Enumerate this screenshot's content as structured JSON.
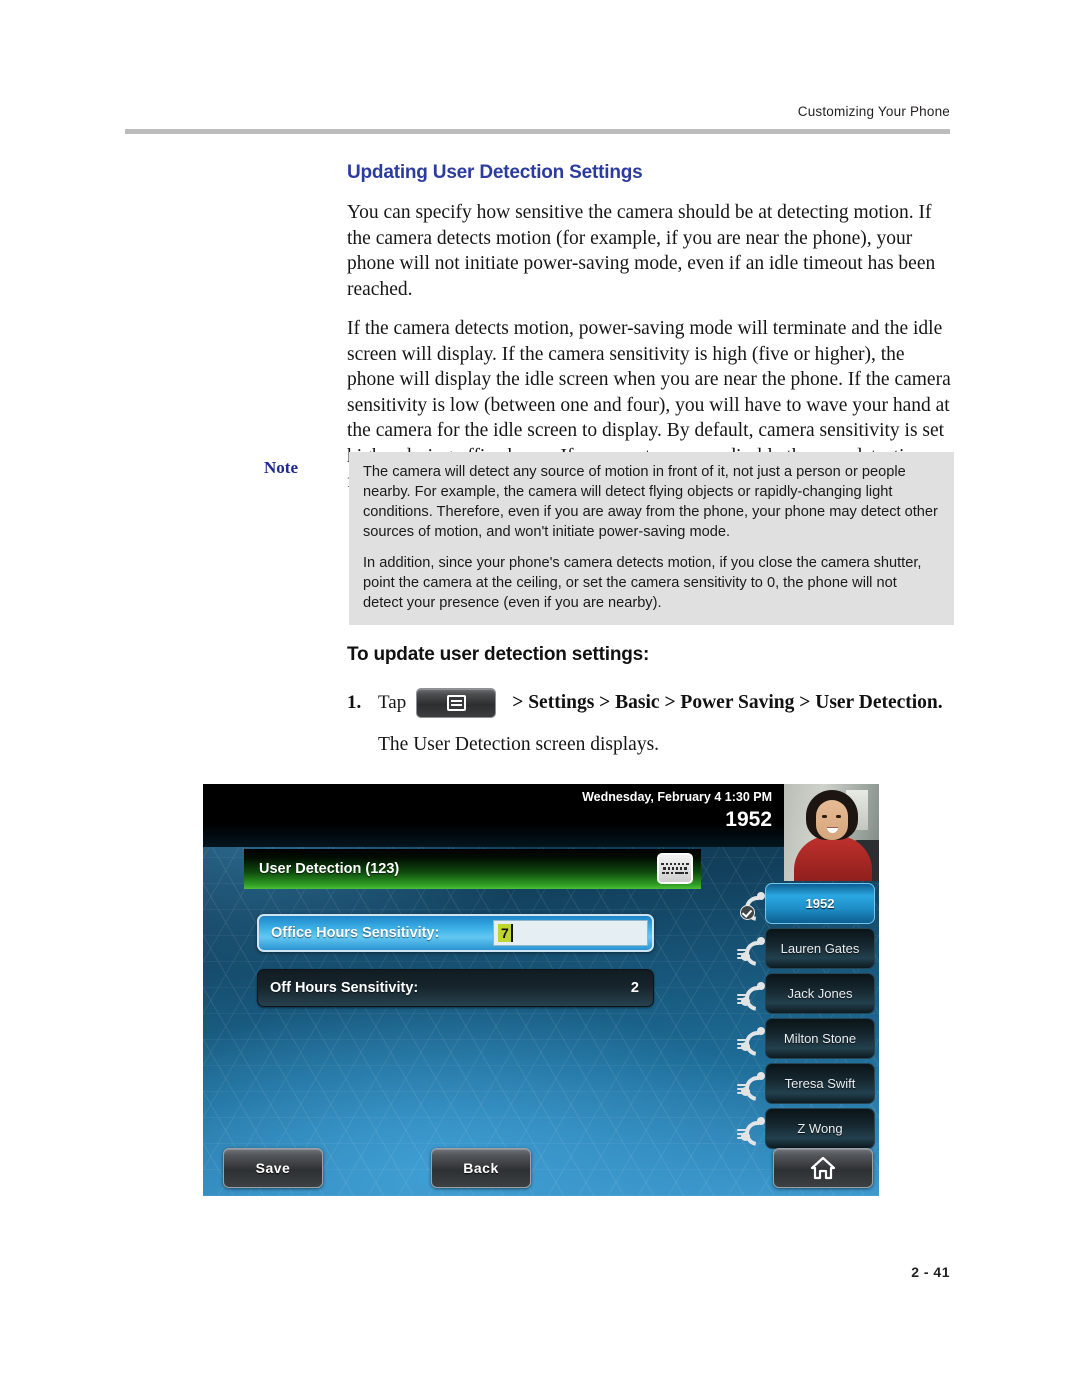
{
  "header": {
    "running_head": "Customizing Your Phone"
  },
  "footer": {
    "page_number": "2 - 41"
  },
  "section": {
    "title": "Updating User Detection Settings",
    "paragraphs": [
      "You can specify how sensitive the camera should be at detecting motion. If the camera detects motion (for example, if you are near the phone), your phone will not initiate power-saving mode, even if an idle timeout has been reached.",
      "If the camera detects motion, power-saving mode will terminate and the idle screen will display. If the camera sensitivity is high (five or higher), the phone will display the idle screen when you are near the phone. If the camera sensitivity is low (between one and four), you will have to wave your hand at the camera for the idle screen to display. By default, camera sensitivity is set higher during office hours. If you want, you can disable the user detection feature altogether."
    ]
  },
  "note": {
    "label": "Note",
    "paragraphs": [
      "The camera will detect any source of motion in front of it, not just a person or people nearby. For example, the camera will detect flying objects or rapidly-changing light conditions. Therefore, even if you are away from the phone, your phone may detect other sources of motion, and won't initiate power-saving mode.",
      "In addition, since your phone's camera detects motion, if you close the camera shutter, point the camera at the ceiling, or set the camera sensitivity to 0, the phone will not detect your presence (even if you are nearby)."
    ]
  },
  "procedure": {
    "title": "To update user detection settings:",
    "step_number": "1.",
    "tap_label": "Tap",
    "menu_icon": "menu-icon",
    "menu_path": "> Settings > Basic > Power Saving > User Detection.",
    "result_text": "The User Detection screen displays."
  },
  "phone_screen": {
    "statusbar": {
      "datetime": "Wednesday, February 4  1:30 PM",
      "extension": "1952"
    },
    "titlebar": {
      "text": "User Detection (123)",
      "keyboard_icon": "keyboard-icon"
    },
    "settings_rows": [
      {
        "label": "Office Hours Sensitivity:",
        "value": "7",
        "selected": true,
        "editing": true
      },
      {
        "label": "Off Hours Sensitivity:",
        "value": "2",
        "selected": false,
        "editing": false
      }
    ],
    "line_keys": [
      {
        "label": "1952",
        "active": true,
        "icon": "handset-registered-icon"
      },
      {
        "label": "Lauren Gates",
        "active": false,
        "icon": "handset-icon"
      },
      {
        "label": "Jack Jones",
        "active": false,
        "icon": "handset-icon"
      },
      {
        "label": "Milton Stone",
        "active": false,
        "icon": "handset-icon"
      },
      {
        "label": "Teresa Swift",
        "active": false,
        "icon": "handset-icon"
      },
      {
        "label": "Z Wong",
        "active": false,
        "icon": "handset-icon"
      }
    ],
    "softkeys": {
      "save": "Save",
      "back": "Back",
      "home_icon": "home-icon"
    }
  },
  "colors": {
    "heading_blue": "#2b3b9e",
    "note_label_blue": "#1c2a8c",
    "note_bg": "#e0e0e0",
    "rule_gray": "#bcbcbc",
    "titlebar_green": "#2e9b22",
    "selected_row_blue": "#3eb2e8",
    "edit_highlight": "#bfd62f"
  }
}
